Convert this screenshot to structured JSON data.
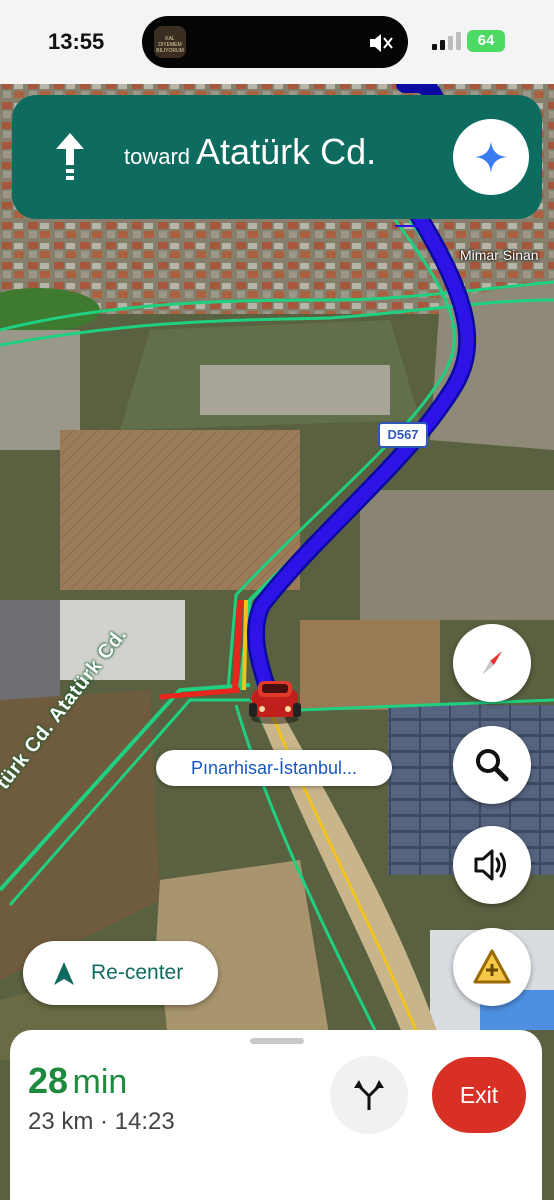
{
  "status_bar": {
    "time": "13:55",
    "battery": "64",
    "island_app_text": "KAL DIYEMEM BILIYORUM",
    "icons": [
      "bell-mute-icon",
      "bluetooth-icon",
      "cellular-signal-icon",
      "charging-icon"
    ]
  },
  "navigation": {
    "direction_icon": "arrow-straight-up-icon",
    "toward": "toward",
    "street": "Atatürk Cd.",
    "assistant_icon": "gemini-spark-icon"
  },
  "map": {
    "place_label": "Mimar Sinan",
    "road_shield": "D567",
    "road_name": "türk Cd. Atatürk Cd.",
    "current_street": "Pınarhisar-İstanbul...",
    "route_color": "#2d13e6",
    "alt_route_color": "#1fd080",
    "traffic_color": "#e8261e"
  },
  "controls": {
    "compass_icon": "compass-icon",
    "search_icon": "search-icon",
    "sound_icon": "speaker-icon",
    "report_icon": "report-incident-icon",
    "recenter_label": "Re-center"
  },
  "trip": {
    "duration_value": "28",
    "duration_unit": "min",
    "summary": "23 km · 14:23",
    "routes_icon": "alternate-routes-icon",
    "exit_label": "Exit"
  },
  "colors": {
    "banner": "#0e6b60",
    "eta": "#1e8a3d",
    "exit": "#d93025",
    "street_pill_text": "#1a57c5"
  }
}
